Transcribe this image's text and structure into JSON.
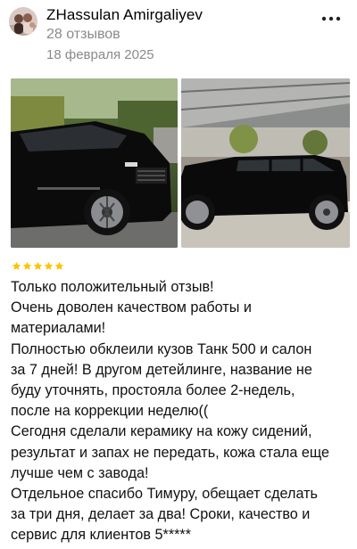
{
  "review": {
    "author_name": "ZHassulan Amirgaliyev",
    "reviews_count": "28 отзывов",
    "date": "18 февраля 2025",
    "more_icon": "more-dots-icon",
    "photos": [
      {
        "icon": "car-photo-front"
      },
      {
        "icon": "car-photo-side"
      }
    ],
    "rating": 5,
    "star_color": "#fcc400",
    "text": "Только положительный отзыв!\nОчень доволен качеством работы и\nматериалами!\nПолностью обклеили кузов Танк 500 и салон\nза 7 дней! В другом детейлинге, название не\nбуду уточнять, простояла более 2-недель,\nпосле на коррекции неделю((\nСегодня сделали керамику на кожу сидений,\nрезультат и запах не передать, кожа стала еще\nлучше чем с завода!\nОтдельное спасибо Тимуру, обещает сделать\nза три дня, делает за два! Сроки, качество и\nсервис для клиентов 5*****"
  }
}
